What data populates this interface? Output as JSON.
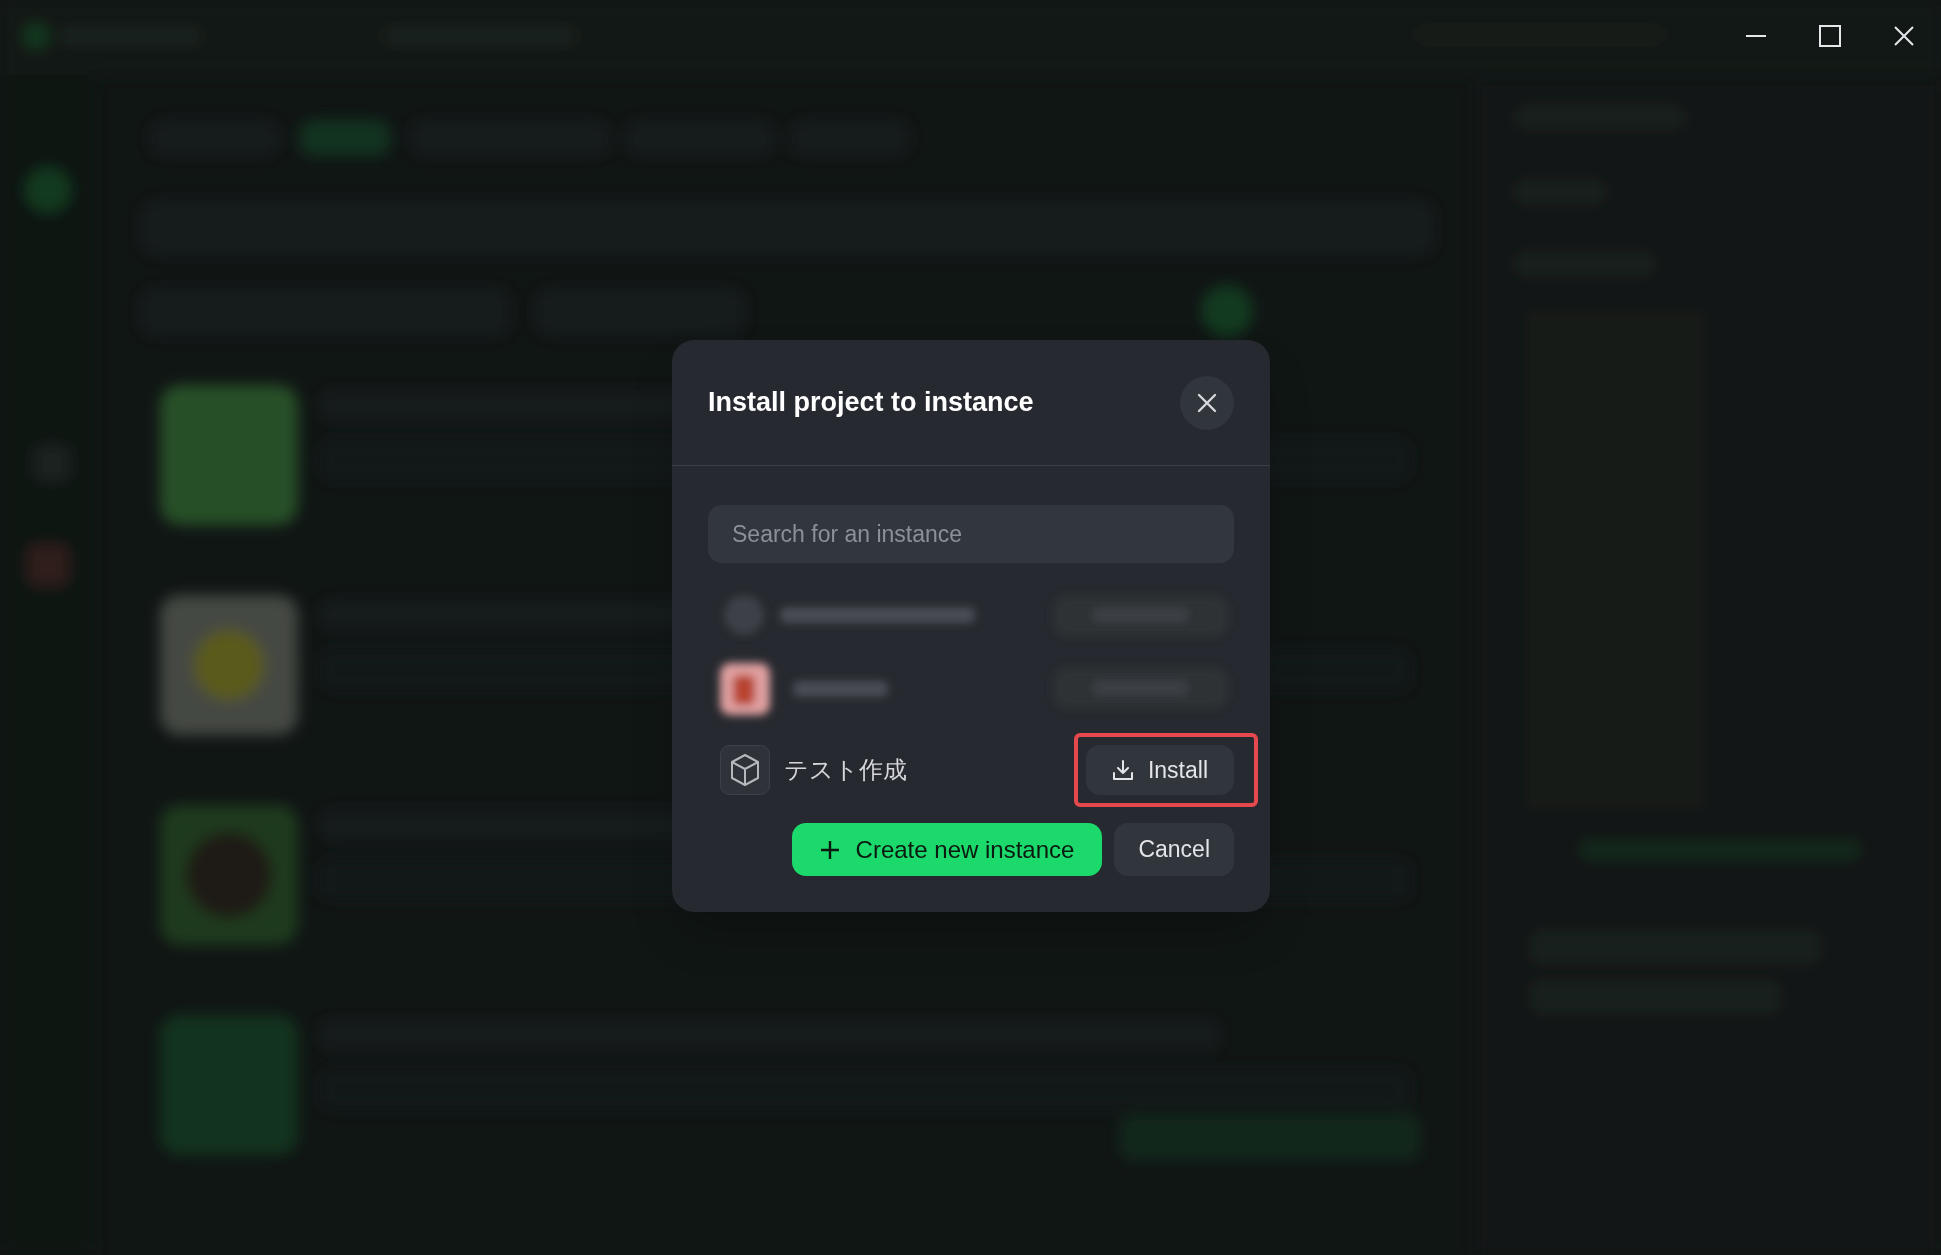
{
  "window_controls": [
    {
      "kind": "minimize"
    },
    {
      "kind": "maximize"
    },
    {
      "kind": "close"
    }
  ],
  "dialog": {
    "title": "Install project to instance",
    "search": {
      "placeholder": "Search for an instance"
    },
    "instances": [
      {
        "name": "テスト作成",
        "action": "Install",
        "highlighted": true
      }
    ],
    "buttons": [
      {
        "kind": "primary",
        "label": "Create new instance"
      },
      {
        "kind": "secondary",
        "label": "Cancel"
      }
    ]
  }
}
